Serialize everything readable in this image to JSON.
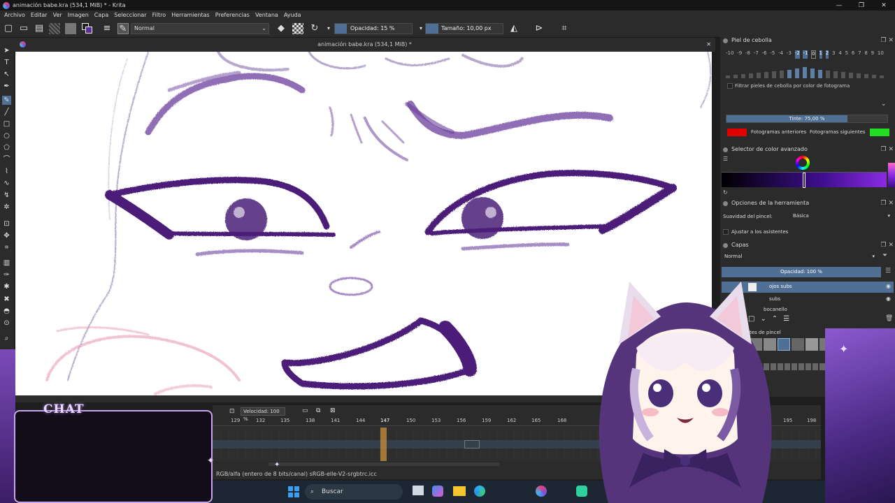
{
  "window": {
    "title": "animación babe.kra (534,1 MiB) * - Krita",
    "buttons": [
      "—",
      "❐",
      "✕"
    ]
  },
  "menu": [
    "Archivo",
    "Editar",
    "Ver",
    "Imagen",
    "Capa",
    "Seleccionar",
    "Filtro",
    "Herramientas",
    "Preferencias",
    "Ventana",
    "Ayuda"
  ],
  "toolbar": {
    "blend_mode": "Normal",
    "opacity_label": "Opacidad: 15 %",
    "opacity_value": 15,
    "size_label": "Tamaño: 10,00 px"
  },
  "document": {
    "tab_title": "animación babe.kra (534,1 MiB) *",
    "close": "✕"
  },
  "onion_skin": {
    "title": "Piel de cebolla",
    "scale": [
      "-10",
      "-9",
      "-8",
      "-7",
      "-6",
      "-5",
      "-4",
      "-3",
      "-2",
      "-1",
      "0",
      "1",
      "2",
      "3",
      "4",
      "5",
      "6",
      "7",
      "8",
      "9",
      "10"
    ],
    "filter_label": "Filtrar pieles de cebolla por color de fotograma",
    "tint_label": "Tinte: 75,00 %",
    "tint_value": 75,
    "prev_label": "Fotogramas anteriores",
    "next_label": "Fotogramas siguientes",
    "prev_color": "#e00000",
    "next_color": "#22dd22"
  },
  "color_selector": {
    "title": "Selector de color avanzado"
  },
  "tool_options": {
    "title": "Opciones de la herramienta",
    "smoothing_label": "Suavidad del pincel:",
    "smoothing_value": "Básica",
    "assistants_label": "Ajustar a los asistentes"
  },
  "layers": {
    "title": "Capas",
    "blend_mode": "Normal",
    "opacity_label": "Opacidad:  100 %",
    "items": [
      {
        "name": "ojos subs"
      },
      {
        "name": "subs"
      },
      {
        "name": "bocanello"
      }
    ]
  },
  "brush_presets": {
    "title": "tes de pincel"
  },
  "timeline": {
    "speed_label": "Velocidad: 100 %",
    "frames": [
      "129",
      "132",
      "135",
      "138",
      "141",
      "144",
      "147",
      "150",
      "153",
      "156",
      "159",
      "162",
      "165",
      "168",
      "195",
      "198"
    ],
    "current_frame": "147"
  },
  "status": {
    "text": "RGB/alfa (entero de 8 bits/canal)  sRGB-elle-V2-srgbtrc.icc"
  },
  "taskbar": {
    "search_placeholder": "Buscar"
  },
  "overlay": {
    "chat_label": "CHAT"
  },
  "colors": {
    "accent": "#4f6f94",
    "ink": "#4b1f78"
  }
}
